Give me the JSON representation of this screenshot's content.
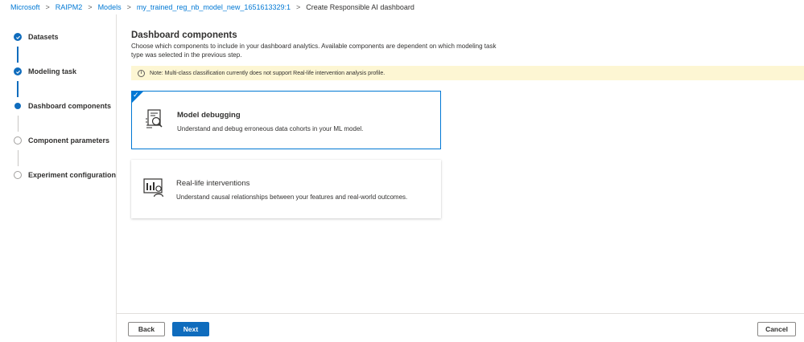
{
  "breadcrumb": {
    "items": [
      "Microsoft",
      "RAIPM2",
      "Models",
      "my_trained_reg_nb_model_new_1651613329:1"
    ],
    "current": "Create Responsible AI dashboard",
    "separator": ">"
  },
  "stepper": {
    "steps": [
      {
        "label": "Datasets",
        "state": "done"
      },
      {
        "label": "Modeling task",
        "state": "done"
      },
      {
        "label": "Dashboard components",
        "state": "current"
      },
      {
        "label": "Component parameters",
        "state": "pending"
      },
      {
        "label": "Experiment configuration",
        "state": "pending"
      }
    ]
  },
  "main": {
    "title": "Dashboard components",
    "description": "Choose which components to include in your dashboard analytics. Available components are dependent on which modeling task type was selected in the previous step.",
    "note": "Note: Multi-class classification currently does not support Real-life intervention analysis profile.",
    "cards": [
      {
        "title": "Model debugging",
        "description": "Understand and debug erroneous data cohorts in your ML model.",
        "selected": true,
        "icon": "model-debugging-icon"
      },
      {
        "title": "Real-life interventions",
        "description": "Understand causal relationships between your features and real-world outcomes.",
        "selected": false,
        "icon": "real-life-interventions-icon"
      }
    ]
  },
  "footer": {
    "back": "Back",
    "next": "Next",
    "cancel": "Cancel"
  },
  "colors": {
    "accent": "#0f6cbd",
    "link": "#0078d4",
    "note_bg": "#fdf6d3"
  }
}
